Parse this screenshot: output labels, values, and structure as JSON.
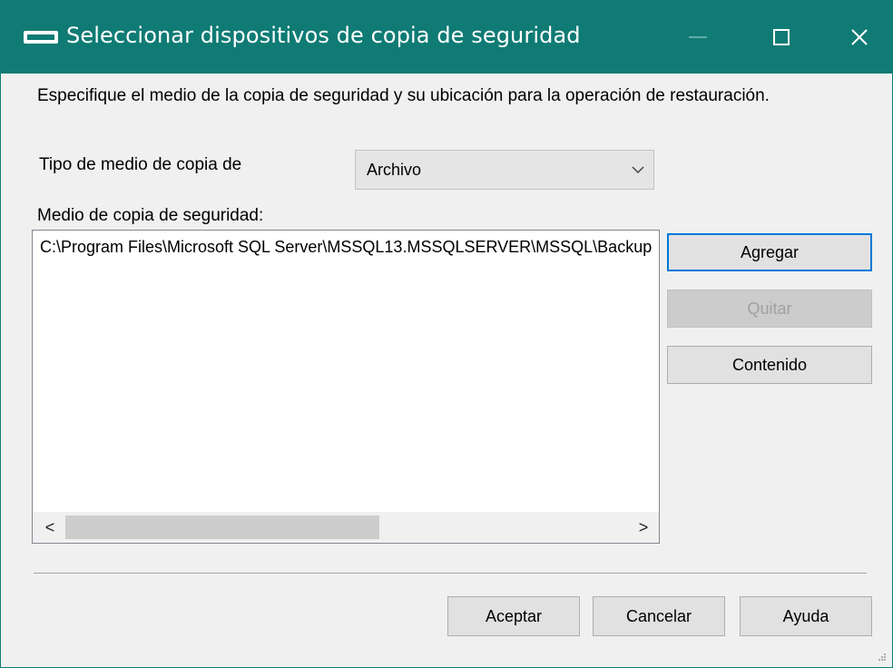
{
  "window": {
    "title": "Seleccionar dispositivos de copia de seguridad",
    "accent_color": "#0f7b74",
    "title_icon": "tape-drive-icon",
    "controls": {
      "minimize": "minimize-icon",
      "maximize": "□",
      "close": "✕"
    }
  },
  "dialog": {
    "description": "Especifique el medio de la copia de seguridad y su ubicación para la operación de restauración.",
    "media_type_label": "Tipo de medio de copia de",
    "media_type_selected": "Archivo",
    "media_list_label": "Medio de copia de seguridad:",
    "media_items": [
      "C:\\Program Files\\Microsoft SQL Server\\MSSQL13.MSSQLSERVER\\MSSQL\\Backup"
    ],
    "scroll": {
      "left": "<",
      "right": ">"
    }
  },
  "buttons": {
    "add": "Agregar",
    "remove": "Quitar",
    "contents": "Contenido",
    "ok": "Aceptar",
    "cancel": "Cancelar",
    "help": "Ayuda"
  }
}
